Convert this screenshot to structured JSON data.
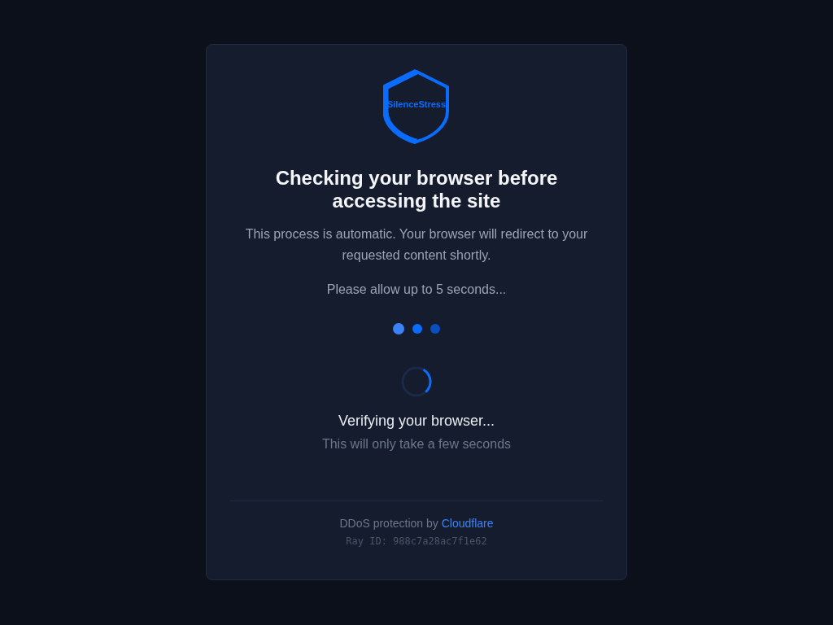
{
  "logo": {
    "text": "SilenceStress"
  },
  "heading": "Checking your browser before accessing the site",
  "description": "This process is automatic. Your browser will redirect to your requested content shortly.",
  "wait_note": "Please allow up to 5 seconds...",
  "dots": [
    {
      "color": "#3b82f6"
    },
    {
      "color": "#0a6cff"
    },
    {
      "color": "#0a4fc0"
    }
  ],
  "status": {
    "title": "Verifying your browser...",
    "subtitle": "This will only take a few seconds"
  },
  "footer": {
    "text": "DDoS protection by",
    "link": "Cloudflare",
    "ray_id": "Ray ID: 988c7a28ac7f1e62"
  }
}
